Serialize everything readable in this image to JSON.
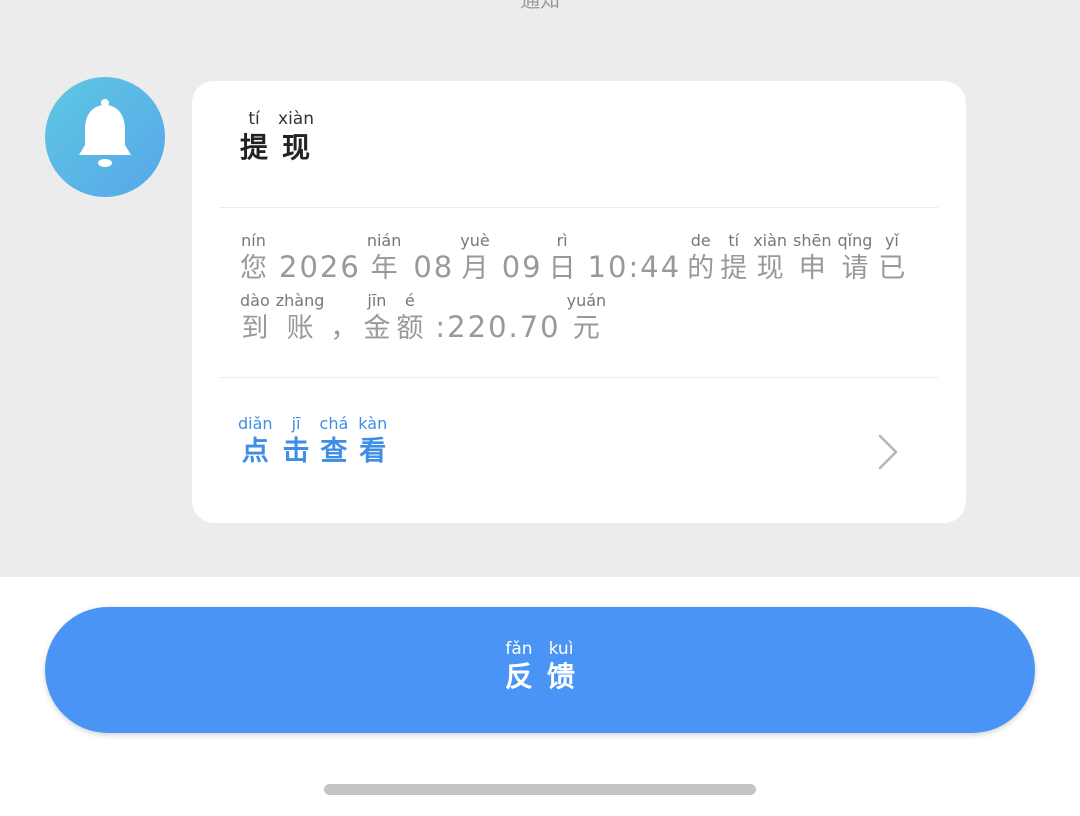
{
  "header": {
    "clipped_title": "通知"
  },
  "avatar": {
    "icon": "bell-icon",
    "gradient": [
      "#5ec8e2",
      "#57a6ea"
    ]
  },
  "card": {
    "title": [
      {
        "py": "tí",
        "hz": "提"
      },
      {
        "py": "xiàn",
        "hz": "现"
      }
    ],
    "body_line1": [
      {
        "py": "nín",
        "hz": "您"
      },
      {
        "num": "2026"
      },
      {
        "py": "nián",
        "hz": "年"
      },
      {
        "num": "08"
      },
      {
        "py": "yuè",
        "hz": "月"
      },
      {
        "num": "09"
      },
      {
        "py": "rì",
        "hz": "日"
      },
      {
        "num": "10:44"
      },
      {
        "py": "de",
        "hz": "的"
      },
      {
        "py": "tí",
        "hz": "提"
      },
      {
        "py": "xiàn",
        "hz": "现"
      },
      {
        "py": "shēn",
        "hz": "申"
      },
      {
        "py": "qǐng",
        "hz": "请"
      },
      {
        "py": "yǐ",
        "hz": "已"
      }
    ],
    "body_line2": [
      {
        "py": "dào",
        "hz": "到"
      },
      {
        "py": "zhàng",
        "hz": "账"
      },
      {
        "py": "",
        "hz": "，"
      },
      {
        "py": "jīn",
        "hz": "金"
      },
      {
        "py": "é",
        "hz": "额"
      },
      {
        "num": ":220.70"
      },
      {
        "py": "yuán",
        "hz": "元"
      }
    ],
    "action": [
      {
        "py": "diǎn",
        "hz": "点"
      },
      {
        "py": "jī",
        "hz": "击"
      },
      {
        "py": "chá",
        "hz": "查"
      },
      {
        "py": "kàn",
        "hz": "看"
      }
    ],
    "action_icon": "chevron-right-icon"
  },
  "feedback": {
    "label": [
      {
        "py": "fǎn",
        "hz": "反"
      },
      {
        "py": "kuì",
        "hz": "馈"
      }
    ]
  },
  "colors": {
    "accent": "#4a94f5",
    "link": "#3e8ee6",
    "background": "#ececec",
    "card": "#ffffff"
  }
}
